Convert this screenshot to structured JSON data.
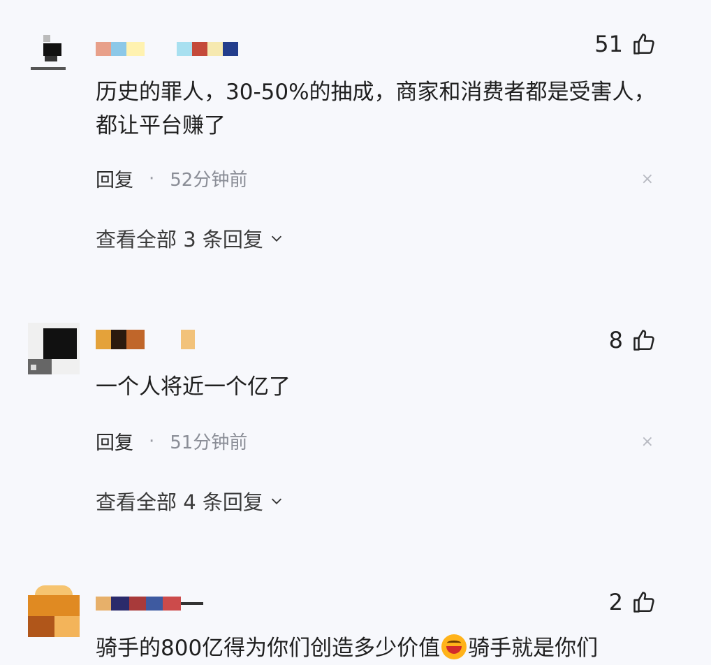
{
  "comments": [
    {
      "likes": "51",
      "text": "历史的罪人，30-50%的抽成，商家和消费者都是受害人，都让平台赚了",
      "reply_label": "回复",
      "dot": "·",
      "time": "52分钟前",
      "close": "×",
      "more_label": "查看全部 3 条回复"
    },
    {
      "likes": "8",
      "text": "一个人将近一个亿了",
      "reply_label": "回复",
      "dot": "·",
      "time": "51分钟前",
      "close": "×",
      "more_label": "查看全部 4 条回复"
    },
    {
      "likes": "2",
      "text_before_emoji": "骑手的800亿得为你们创造多少价值",
      "text_after_emoji": "骑手就是你们"
    }
  ],
  "icons": {
    "like": "thumbs-up-icon",
    "expand": "chevron-down-icon",
    "emoji": "laughing-emoji-icon"
  }
}
